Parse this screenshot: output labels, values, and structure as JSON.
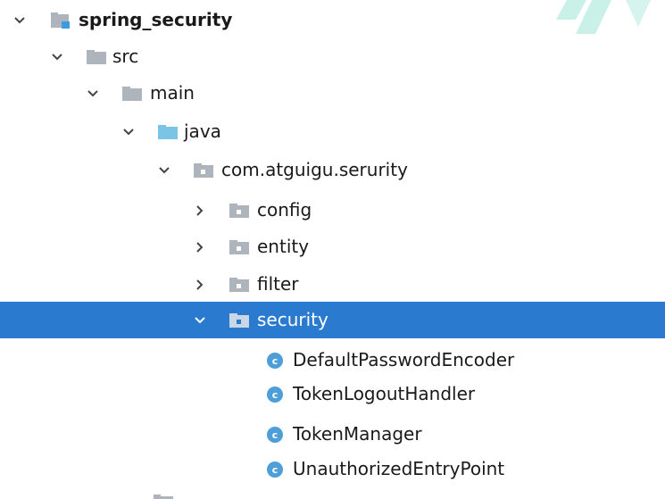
{
  "tree": {
    "root": {
      "label": "spring_security",
      "icon": "module-folder-icon",
      "expanded": true
    },
    "src": {
      "label": "src",
      "icon": "folder-icon",
      "expanded": true
    },
    "main": {
      "label": "main",
      "icon": "folder-icon",
      "expanded": true
    },
    "java": {
      "label": "java",
      "icon": "source-root-folder-icon",
      "expanded": true
    },
    "package": {
      "label": "com.atguigu.serurity",
      "icon": "package-icon",
      "expanded": true
    },
    "config": {
      "label": "config",
      "icon": "package-icon",
      "expanded": false
    },
    "entity": {
      "label": "entity",
      "icon": "package-icon",
      "expanded": false
    },
    "filter": {
      "label": "filter",
      "icon": "package-icon",
      "expanded": false
    },
    "security": {
      "label": "security",
      "icon": "package-icon",
      "expanded": true,
      "selected": true
    },
    "classes": [
      {
        "label": "DefaultPasswordEncoder",
        "icon": "java-class-icon",
        "glyph": "c"
      },
      {
        "label": "TokenLogoutHandler",
        "icon": "java-class-icon",
        "glyph": "c"
      },
      {
        "label": "TokenManager",
        "icon": "java-class-icon",
        "glyph": "c"
      },
      {
        "label": "UnauthorizedEntryPoint",
        "icon": "java-class-icon",
        "glyph": "c"
      }
    ]
  },
  "colors": {
    "selection": "#2a7bd0",
    "folder": "#aeb4bb",
    "source_folder": "#7cc3e8",
    "class_icon": "#4e9ed8",
    "chevron": "#444444",
    "watermark": "#bfeee4"
  }
}
